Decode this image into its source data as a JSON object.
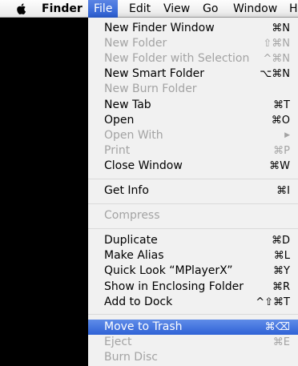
{
  "menubar": {
    "apple_icon": "apple-logo-icon",
    "items": [
      {
        "label": "Finder"
      },
      {
        "label": "File"
      },
      {
        "label": "Edit"
      },
      {
        "label": "View"
      },
      {
        "label": "Go"
      },
      {
        "label": "Window"
      },
      {
        "label": "H"
      }
    ]
  },
  "menu": {
    "groups": [
      [
        {
          "label": "New Finder Window",
          "shortcut": "⌘N",
          "enabled": true
        },
        {
          "label": "New Folder",
          "shortcut": "⇧⌘N",
          "enabled": false
        },
        {
          "label": "New Folder with Selection",
          "shortcut": "^⌘N",
          "enabled": false
        },
        {
          "label": "New Smart Folder",
          "shortcut": "⌥⌘N",
          "enabled": true
        },
        {
          "label": "New Burn Folder",
          "shortcut": "",
          "enabled": false
        },
        {
          "label": "New Tab",
          "shortcut": "⌘T",
          "enabled": true
        },
        {
          "label": "Open",
          "shortcut": "⌘O",
          "enabled": true
        },
        {
          "label": "Open With",
          "shortcut": "▶",
          "enabled": false
        },
        {
          "label": "Print",
          "shortcut": "⌘P",
          "enabled": false
        },
        {
          "label": "Close Window",
          "shortcut": "⌘W",
          "enabled": true
        }
      ],
      [
        {
          "label": "Get Info",
          "shortcut": "⌘I",
          "enabled": true
        }
      ],
      [
        {
          "label": "Compress",
          "shortcut": "",
          "enabled": false
        }
      ],
      [
        {
          "label": "Duplicate",
          "shortcut": "⌘D",
          "enabled": true
        },
        {
          "label": "Make Alias",
          "shortcut": "⌘L",
          "enabled": true
        },
        {
          "label": "Quick Look “MPlayerX”",
          "shortcut": "⌘Y",
          "enabled": true
        },
        {
          "label": "Show in Enclosing Folder",
          "shortcut": "⌘R",
          "enabled": true
        },
        {
          "label": "Add to Dock",
          "shortcut": "^⇧⌘T",
          "enabled": true
        }
      ],
      [
        {
          "label": "Move to Trash",
          "shortcut": "⌘⌫",
          "enabled": true,
          "highlighted": true
        },
        {
          "label": "Eject",
          "shortcut": "⌘E",
          "enabled": false
        },
        {
          "label": "Burn Disc",
          "shortcut": "",
          "enabled": false
        }
      ]
    ]
  },
  "colors": {
    "highlight": "#2f62d6",
    "disabled_text": "#a3a3a3",
    "menu_background": "#f6f6f6",
    "desktop": "#000000"
  }
}
